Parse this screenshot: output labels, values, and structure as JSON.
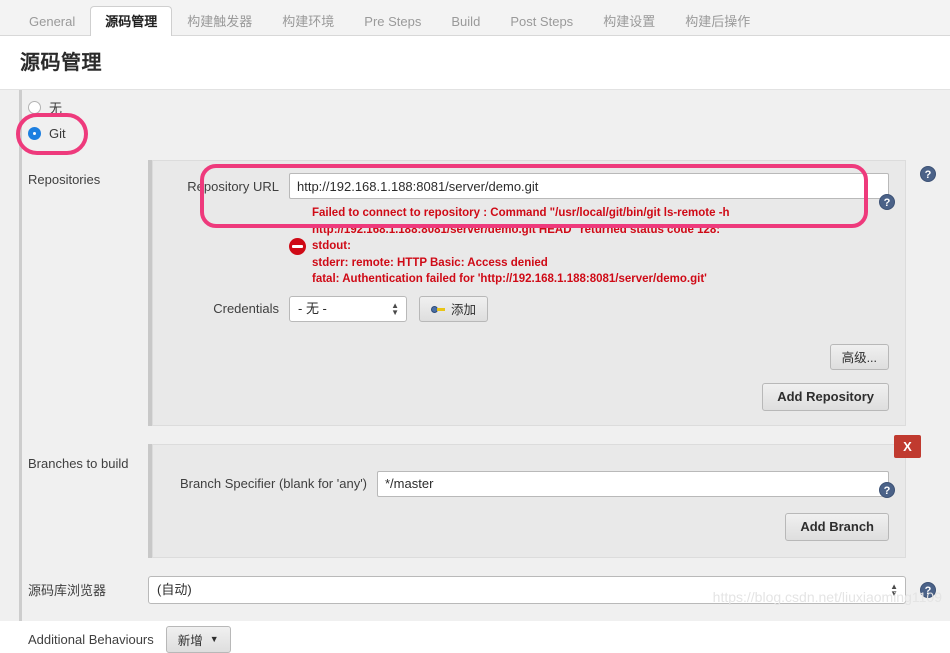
{
  "tabs": [
    {
      "label": "General",
      "active": false
    },
    {
      "label": "源码管理",
      "active": true
    },
    {
      "label": "构建触发器",
      "active": false
    },
    {
      "label": "构建环境",
      "active": false
    },
    {
      "label": "Pre Steps",
      "active": false
    },
    {
      "label": "Build",
      "active": false
    },
    {
      "label": "Post Steps",
      "active": false
    },
    {
      "label": "构建设置",
      "active": false
    },
    {
      "label": "构建后操作",
      "active": false
    }
  ],
  "page": {
    "title": "源码管理"
  },
  "scm": {
    "options": [
      {
        "label": "无",
        "checked": false
      },
      {
        "label": "Git",
        "checked": true
      }
    ]
  },
  "repositories": {
    "label": "Repositories",
    "url_label": "Repository URL",
    "url_value": "http://192.168.1.188:8081/server/demo.git",
    "error_icon": "no-entry-icon",
    "error_lines": [
      "Failed to connect to repository : Command \"/usr/local/git/bin/git ls-remote -h",
      "http://192.168.1.188:8081/server/demo.git HEAD\" returned status code 128:",
      "stdout:",
      "stderr: remote: HTTP Basic: Access denied",
      "fatal: Authentication failed for 'http://192.168.1.188:8081/server/demo.git'"
    ],
    "credentials_label": "Credentials",
    "credentials_value": "- 无 -",
    "add_credentials_label": "添加",
    "advanced_label": "高级...",
    "add_repository_label": "Add Repository"
  },
  "branches": {
    "label": "Branches to build",
    "specifier_label": "Branch Specifier (blank for 'any')",
    "specifier_value": "*/master",
    "remove_label": "X",
    "add_branch_label": "Add Branch"
  },
  "browser": {
    "label": "源码库浏览器",
    "value": "(自动)"
  },
  "additional": {
    "label": "Additional Behaviours",
    "add_label": "新增"
  },
  "help_icon": "?",
  "watermark": "https://blog.csdn.net/liuxiaoming1109",
  "colors": {
    "accent_blue": "#1d7fe0",
    "error_red": "#cf0a16",
    "annotation_pink": "#ee3a7c",
    "delete_red": "#c03a2f"
  }
}
